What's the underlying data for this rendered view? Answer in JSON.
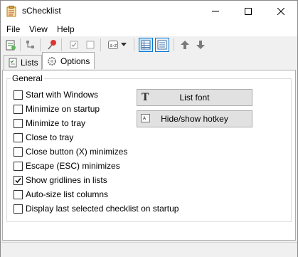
{
  "app": {
    "title": "sChecklist"
  },
  "menu": [
    "File",
    "View",
    "Help"
  ],
  "toolbar": {
    "icons": [
      "new-list-icon",
      "tree-icon",
      "pin-icon",
      "check-all-icon",
      "uncheck-all-icon",
      "sort-icon",
      "dropdown-arrow-icon",
      "view-list-icon",
      "view-detail-icon",
      "move-up-icon",
      "move-down-icon"
    ]
  },
  "tabs": [
    {
      "label": "Lists",
      "active": false
    },
    {
      "label": "Options",
      "active": true
    }
  ],
  "options": {
    "group_label": "General",
    "checkboxes": [
      {
        "label": "Start with Windows",
        "checked": false
      },
      {
        "label": "Minimize on startup",
        "checked": false
      },
      {
        "label": "Minimize to tray",
        "checked": false
      },
      {
        "label": "Close to tray",
        "checked": false
      },
      {
        "label": "Close button (X) minimizes",
        "checked": false
      },
      {
        "label": "Escape (ESC) minimizes",
        "checked": false
      },
      {
        "label": "Show gridlines in lists",
        "checked": true
      },
      {
        "label": "Auto-size list columns",
        "checked": false
      },
      {
        "label": "Display last selected checklist on startup",
        "checked": false
      }
    ],
    "buttons": {
      "list_font": "List font",
      "hide_show_hotkey": "Hide/show hotkey"
    }
  },
  "colors": {
    "accent": "#0078d7",
    "title_bg": "#ffffff",
    "window_bg": "#f0f0f0"
  }
}
